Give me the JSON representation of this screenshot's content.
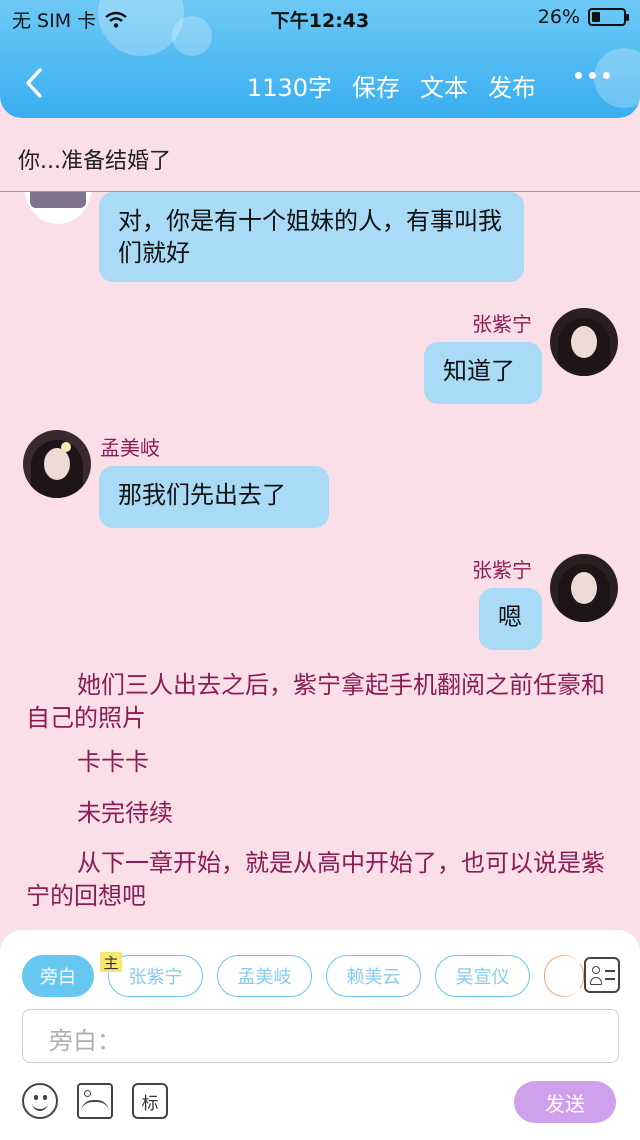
{
  "status_bar": {
    "carrier": "无 SIM 卡",
    "time": "下午12:43",
    "battery": "26%",
    "battery_level": 0.26
  },
  "toolbar": {
    "word_count": "1130字",
    "save_label": "保存",
    "text_label": "文本",
    "publish_label": "发布"
  },
  "chapter_title": "你...准备结婚了",
  "messages": [
    {
      "speaker": "孟美岐",
      "side": "left",
      "text": "对，你是有十个姐妹的人，有事叫我们就好"
    },
    {
      "speaker": "张紫宁",
      "side": "right",
      "text": "知道了"
    },
    {
      "speaker": "孟美岐",
      "side": "left",
      "text": "那我们先出去了"
    },
    {
      "speaker": "张紫宁",
      "side": "right",
      "text": "嗯"
    }
  ],
  "narration": [
    "她们三人出去之后，紫宁拿起手机翻阅之前任豪和自己的照片",
    "卡卡卡",
    "未完待续",
    "从下一章开始，就是从高中开始了，也可以说是紫宁的回想吧"
  ],
  "composer": {
    "roles": [
      "旁白",
      "张紫宁",
      "孟美岐",
      "赖美云",
      "吴宣仪"
    ],
    "main_badge": "主",
    "input_placeholder": "旁白：",
    "mark_label": "标",
    "send_label": "发送",
    "colors": {
      "active_chip": "#66c8f0",
      "send_button": "#cfa0ec",
      "partial_chip": "#f2a56a"
    }
  },
  "colors": {
    "background": "#fbdfe8",
    "header": "#38aef0",
    "bubble": "#a9daf6",
    "name_text": "#8a1d55"
  }
}
